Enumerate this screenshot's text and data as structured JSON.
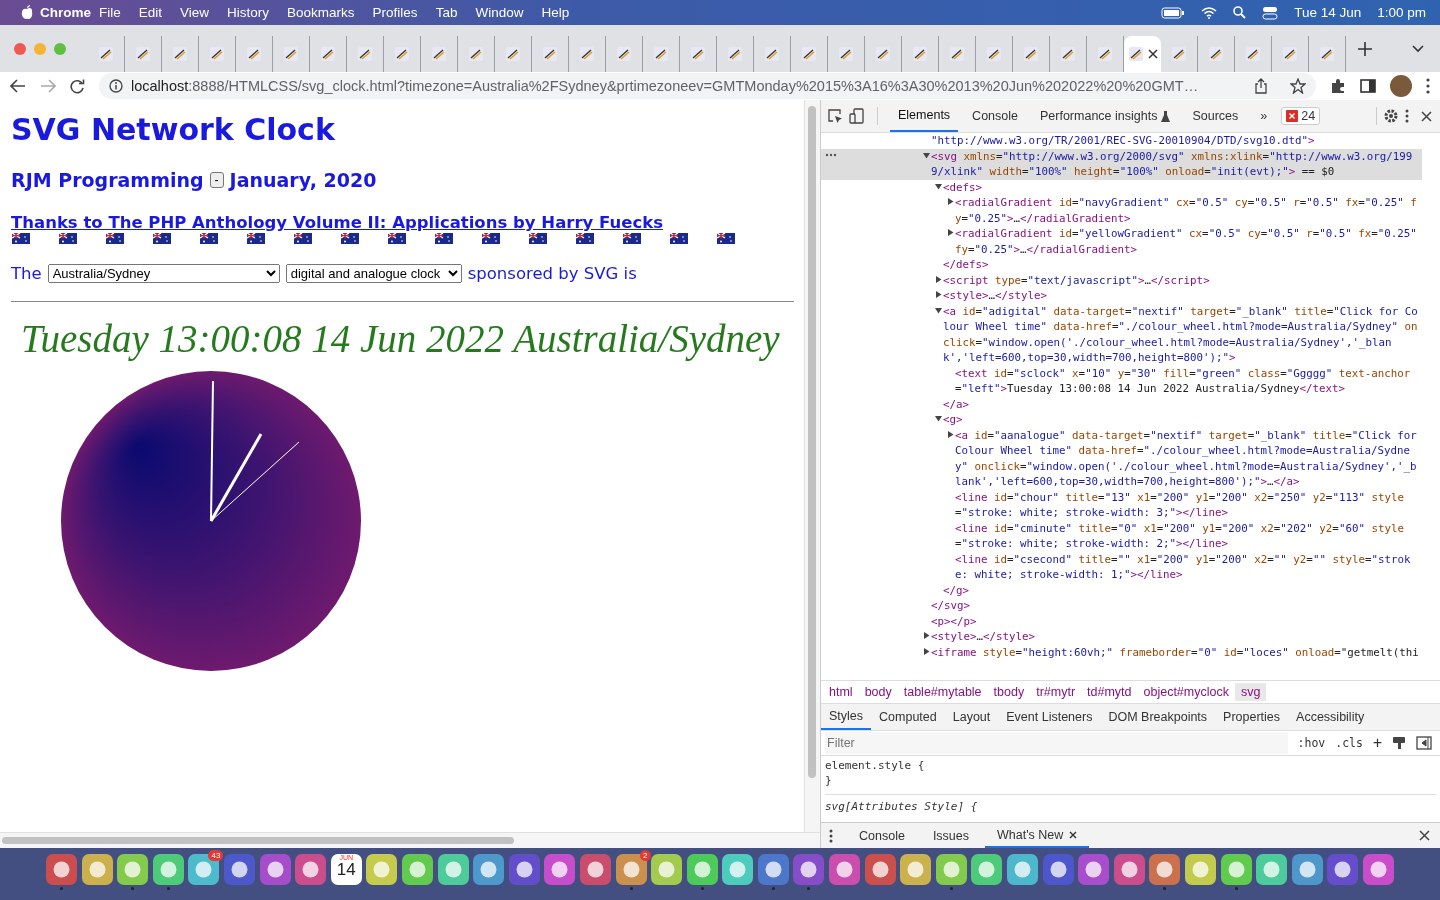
{
  "menu_bar": {
    "app": "Chrome",
    "items": [
      "File",
      "Edit",
      "View",
      "History",
      "Bookmarks",
      "Profiles",
      "Tab",
      "Window",
      "Help"
    ],
    "date": "Tue 14 Jun",
    "time": "1:00 pm"
  },
  "tabs": [
    {
      "selected": false
    },
    {
      "selected": false
    },
    {
      "selected": false
    },
    {
      "selected": false
    },
    {
      "selected": false
    },
    {
      "selected": false
    },
    {
      "selected": false
    },
    {
      "selected": false
    },
    {
      "selected": false
    },
    {
      "selected": false
    },
    {
      "selected": false
    },
    {
      "selected": false
    },
    {
      "selected": false
    },
    {
      "selected": false
    },
    {
      "selected": false
    },
    {
      "selected": false
    },
    {
      "selected": false
    },
    {
      "selected": false
    },
    {
      "selected": false
    },
    {
      "selected": false
    },
    {
      "selected": false
    },
    {
      "selected": false
    },
    {
      "selected": false
    },
    {
      "selected": false
    },
    {
      "selected": false
    },
    {
      "selected": false
    },
    {
      "selected": false
    },
    {
      "selected": false
    },
    {
      "selected": true
    },
    {
      "selected": false
    },
    {
      "selected": false
    },
    {
      "selected": false
    },
    {
      "selected": false
    },
    {
      "selected": false
    }
  ],
  "address_bar": {
    "host": "localhost",
    "path": ":8888/HTMLCSS/svg_clock.html?timezone=Australia%2FSydney&prtimezoneev=GMTMonday%2015%3A16%3A30%2013%20Jun%202022%20%20GMT…"
  },
  "page": {
    "title": "SVG Network Clock",
    "byline": "RJM Programming",
    "toggle_button": "-",
    "date": "January, 2020",
    "credit_link": "Thanks to The PHP Anthology Volume II: Applications by Harry Fuecks",
    "prefix": "The",
    "timezone_select": "Australia/Sydney",
    "mode_select": "digital and analogue clock",
    "suffix": "sponsored by SVG is",
    "digital_time": "Tuesday 13:00:08 14 Jun 2022 Australia/Sydney"
  },
  "devtools": {
    "tabs": [
      {
        "label": "Elements",
        "selected": true
      },
      {
        "label": "Console",
        "selected": false
      },
      {
        "label": "Performance insights",
        "selected": false
      },
      {
        "label": "Sources",
        "selected": false
      }
    ],
    "more": "»",
    "error_count": "24",
    "dom_tree": [
      {
        "text": "\"http://www.w3.org/TR/2001/REC-SVG-20010904/DTD/svg10.dtd\">",
        "selected": false
      },
      {
        "text": "<svg xmlns=\"http://www.w3.org/2000/svg\" xmlns:xlink=\"http://www.w3.org/1999/xlink\" width=\"100%\" height=\"100%\" onload=\"init(evt);\"> == $0",
        "selected": true,
        "expanded": true,
        "closing": "</svg>",
        "children": [
          {
            "text": "<defs>",
            "selected": false,
            "expanded": true,
            "closing": "</defs>",
            "children": [
              {
                "text": "<radialGradient id=\"navyGradient\" cx=\"0.5\" cy=\"0.5\" r=\"0.5\" fx=\"0.25\" fy=\"0.25\">…</radialGradient>",
                "selected": false,
                "expanded": false
              },
              {
                "text": "<radialGradient id=\"yellowGradient\" cx=\"0.5\" cy=\"0.5\" r=\"0.5\" fx=\"0.25\" fy=\"0.25\">…</radialGradient>",
                "selected": false,
                "expanded": false
              }
            ]
          },
          {
            "text": "<script type=\"text/javascript\">…</script>",
            "selected": false,
            "expanded": false
          },
          {
            "text": "<style>…</style>",
            "selected": false,
            "expanded": false
          },
          {
            "text": "<a id=\"adigital\" data-target=\"nextif\" target=\"_blank\" title=\"Click for Colour Wheel time\" data-href=\"./colour_wheel.html?mode=Australia/Sydney\" onclick=\"window.open('./colour_wheel.html?mode=Australia/Sydney','_blank','left=600,top=30,width=700,height=800');\">",
            "selected": false,
            "expanded": true,
            "closing": "</a>",
            "children": [
              {
                "text": "<text id=\"sclock\" x=\"10\" y=\"30\" fill=\"green\" class=\"Ggggg\" text-anchor=\"left\">Tuesday 13:00:08 14 Jun 2022 Australia/Sydney</text>",
                "selected": false
              }
            ]
          },
          {
            "text": "<g>",
            "selected": false,
            "expanded": true,
            "closing": "</g>",
            "children": [
              {
                "text": "<a id=\"aanalogue\" data-target=\"nextif\" target=\"_blank\" title=\"Click for Colour Wheel time\" data-href=\"./colour_wheel.html?mode=Australia/Sydney\" onclick=\"window.open('./colour_wheel.html?mode=Australia/Sydney','_blank','left=600,top=30,width=700,height=800');\">…</a>",
                "selected": false,
                "expanded": false
              },
              {
                "text": "<line id=\"chour\" title=\"13\" x1=\"200\" y1=\"200\" x2=\"250\" y2=\"113\" style=\"stroke: white; stroke-width: 3;\"></line>",
                "selected": false
              },
              {
                "text": "<line id=\"cminute\" title=\"0\" x1=\"200\" y1=\"200\" x2=\"202\" y2=\"60\" style=\"stroke: white; stroke-width: 2;\"></line>",
                "selected": false
              },
              {
                "text": "<line id=\"csecond\" title=\"\" x1=\"200\" y1=\"200\" x2=\"\" y2=\"\" style=\"stroke: white; stroke-width: 1;\"></line>",
                "selected": false
              }
            ]
          }
        ]
      },
      {
        "text": "<p></p>",
        "selected": false
      },
      {
        "text": "<style>…</style>",
        "selected": false,
        "expanded": false
      },
      {
        "text": "<iframe style=\"height:60vh;\" frameborder=\"0\" id=\"loces\" onload=\"getmelt(thi",
        "selected": false,
        "expanded": false
      }
    ],
    "breadcrumbs": [
      {
        "label": "html",
        "selected": false
      },
      {
        "label": "body",
        "selected": false
      },
      {
        "label": "table#mytable",
        "selected": false
      },
      {
        "label": "tbody",
        "selected": false
      },
      {
        "label": "tr#mytr",
        "selected": false
      },
      {
        "label": "td#mytd",
        "selected": false
      },
      {
        "label": "object#myclock",
        "selected": false
      },
      {
        "label": "svg",
        "selected": true
      }
    ],
    "style_tabs": [
      {
        "label": "Styles",
        "selected": true
      },
      {
        "label": "Computed",
        "selected": false
      },
      {
        "label": "Layout",
        "selected": false
      },
      {
        "label": "Event Listeners",
        "selected": false
      },
      {
        "label": "DOM Breakpoints",
        "selected": false
      },
      {
        "label": "Properties",
        "selected": false
      },
      {
        "label": "Accessibility",
        "selected": false
      }
    ],
    "filter": {
      "placeholder": "Filter"
    },
    "hov": ":hov",
    "cls": ".cls",
    "add": "+",
    "rules": [
      {
        "text": "element.style {",
        "italic": false
      },
      {
        "text": "}",
        "italic": false
      },
      {
        "text": "svg[Attributes Style] {",
        "italic": true
      }
    ],
    "drawer_tabs": [
      {
        "label": "Console",
        "selected": false,
        "closable": false
      },
      {
        "label": "Issues",
        "selected": false,
        "closable": false
      },
      {
        "label": "What's New",
        "selected": true,
        "closable": true
      }
    ]
  },
  "dock": [
    {
      "running": true
    },
    {
      "running": false
    },
    {
      "running": true
    },
    {
      "running": true
    },
    {
      "running": false,
      "badge": "43"
    },
    {
      "running": false
    },
    {
      "running": false
    },
    {
      "running": false
    },
    {
      "running": false,
      "caption": "JUN",
      "day": "14"
    },
    {
      "running": false
    },
    {
      "running": false
    },
    {
      "running": false
    },
    {
      "running": false
    },
    {
      "running": false
    },
    {
      "running": false
    },
    {
      "running": false
    },
    {
      "running": true,
      "badge": "2"
    },
    {
      "running": false
    },
    {
      "running": true
    },
    {
      "running": false
    },
    {
      "running": true
    },
    {
      "running": true
    },
    {
      "running": false
    },
    {
      "running": false
    },
    {
      "running": false
    },
    {
      "running": true
    },
    {
      "running": false
    },
    {
      "running": false
    },
    {
      "running": false
    },
    {
      "running": false
    },
    {
      "running": false
    },
    {
      "running": true
    },
    {
      "running": false
    },
    {
      "running": true
    },
    {
      "running": false
    },
    {
      "running": false
    },
    {
      "running": false
    },
    {
      "running": false
    }
  ]
}
